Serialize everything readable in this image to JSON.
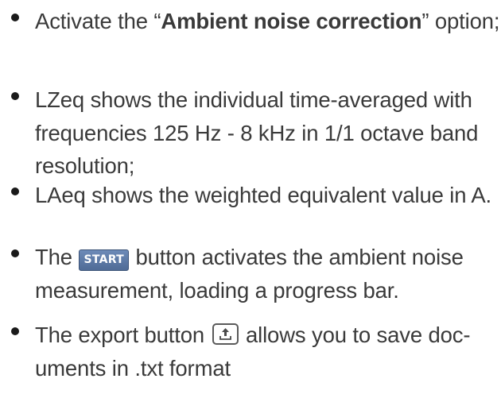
{
  "items": [
    {
      "pre": "Activate the “",
      "bold": "Ambient noise correction",
      "post": "” option;"
    },
    {
      "text": "LZeq shows the individual time-averaged with frequencies 125 Hz - 8 kHz in 1/1 octave band resolution;"
    },
    {
      "text": "LAeq shows the weighted equivalent value in A."
    },
    {
      "pre": "The ",
      "button_label": "START",
      "post": " button activates the ambient noise measurement, loading a progress bar."
    },
    {
      "pre": "The export button ",
      "button_icon": "export-icon",
      "post": " allows you to save doc-uments in .txt format"
    }
  ]
}
